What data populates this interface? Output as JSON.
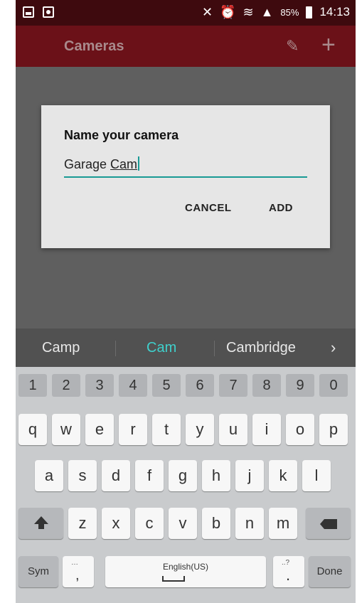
{
  "status_bar": {
    "battery": "85%",
    "time": "14:13"
  },
  "action_bar": {
    "title": "Cameras"
  },
  "dialog": {
    "title": "Name your camera",
    "input_value_start": "Garage ",
    "input_value_end": "Cam",
    "cancel": "CANCEL",
    "add": "ADD"
  },
  "suggestions": [
    "Camp",
    "Cam",
    "Cambridge",
    "›"
  ],
  "keyboard": {
    "numbers": [
      "1",
      "2",
      "3",
      "4",
      "5",
      "6",
      "7",
      "8",
      "9",
      "0"
    ],
    "row1": [
      "q",
      "w",
      "e",
      "r",
      "t",
      "y",
      "u",
      "i",
      "o",
      "p"
    ],
    "row2": [
      "a",
      "s",
      "d",
      "f",
      "g",
      "h",
      "j",
      "k",
      "l"
    ],
    "row3": [
      "z",
      "x",
      "c",
      "v",
      "b",
      "n",
      "m"
    ],
    "sym": "Sym",
    "comma": ",",
    "comma_hint": "…",
    "space_label": "English(US)",
    "period": ".",
    "period_hint": "..?",
    "done": "Done"
  },
  "colors": {
    "statusbar": "#3e0a0e",
    "actionbar": "#6b1118",
    "accent": "#199a95",
    "suggest_active": "#3fd0cc"
  }
}
